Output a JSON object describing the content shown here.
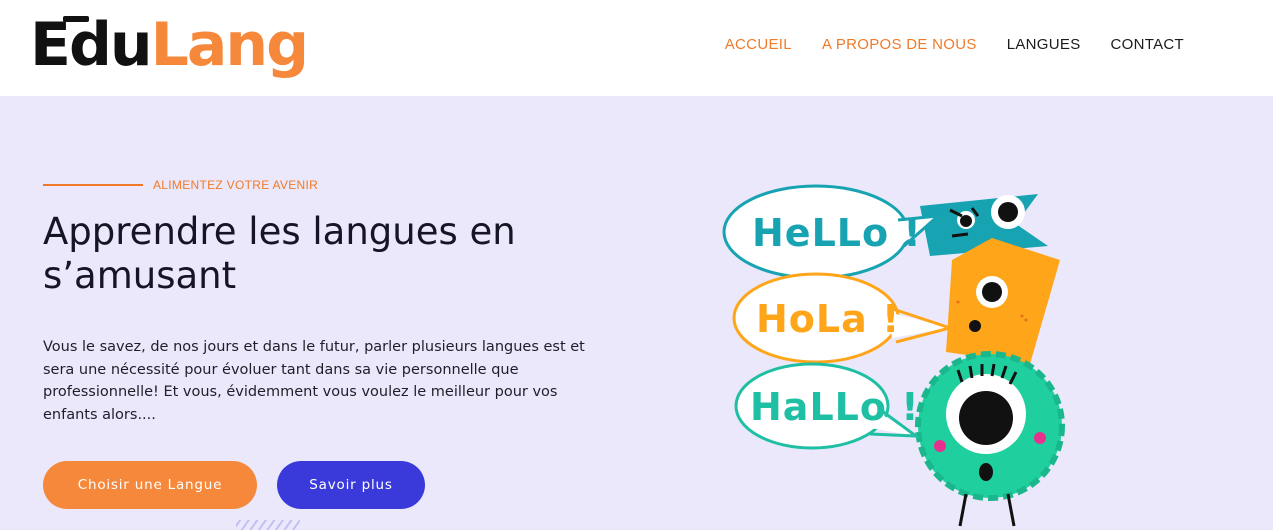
{
  "brand": {
    "logo_part1": "Edu",
    "logo_part2": "Lang"
  },
  "nav": {
    "items": [
      {
        "label": "ACCUEIL",
        "active": true
      },
      {
        "label": "A PROPOS DE NOUS",
        "active": true
      },
      {
        "label": "LANGUES",
        "active": false
      },
      {
        "label": "CONTACT",
        "active": false
      }
    ]
  },
  "hero": {
    "eyebrow": "ALIMENTEZ VOTRE AVENIR",
    "title": "Apprendre les langues en s’amusant",
    "text": "Vous le savez, de nos jours et dans le futur, parler plusieurs langues est et sera une nécessité pour évoluer tant dans sa vie personnelle que professionnelle! Et vous, évidemment vous voulez le meilleur pour vos enfants alors....",
    "primary_button": "Choisir une Langue",
    "secondary_button": "Savoir plus"
  },
  "illustration": {
    "bubble1": "HeLLo !",
    "bubble2": "HoLa !",
    "bubble3": "HaLLo !"
  },
  "colors": {
    "accent_orange": "#f07a2a",
    "button_orange": "#f5883a",
    "button_blue": "#3a3adb",
    "hero_bg": "#eae8fa",
    "teal": "#17a3b1",
    "green_monster": "#1fcf9e",
    "yellow_monster": "#ffa51a"
  }
}
